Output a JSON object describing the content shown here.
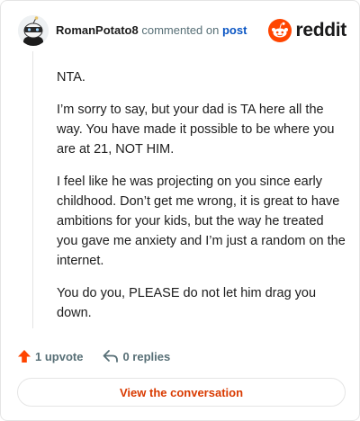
{
  "header": {
    "username": "RomanPotato8",
    "commented_on": "commented on",
    "post_link": "post",
    "logo_text": "reddit"
  },
  "comment": {
    "paragraphs": [
      "NTA.",
      "I’m sorry to say, but your dad is TA here all the way. You have made it possible to be where you are at 21, NOT HIM.",
      "I feel like he was projecting on you since early childhood. Don’t get me wrong, it is great to have ambitions for your kids, but the way he treated you gave me anxiety and I’m just a random on the internet.",
      "You do you, PLEASE do not let him drag you down."
    ]
  },
  "actions": {
    "upvote_label": "1 upvote",
    "replies_label": "0 replies"
  },
  "footer": {
    "view_conversation_label": "View the conversation"
  },
  "colors": {
    "brand": "#ff4500",
    "link": "#0b56c4",
    "button_text": "#d93a00",
    "muted": "#576f76"
  },
  "icons": [
    "avatar-snoo",
    "reddit-logo-icon",
    "upvote-arrow-icon",
    "reply-arrow-icon"
  ]
}
